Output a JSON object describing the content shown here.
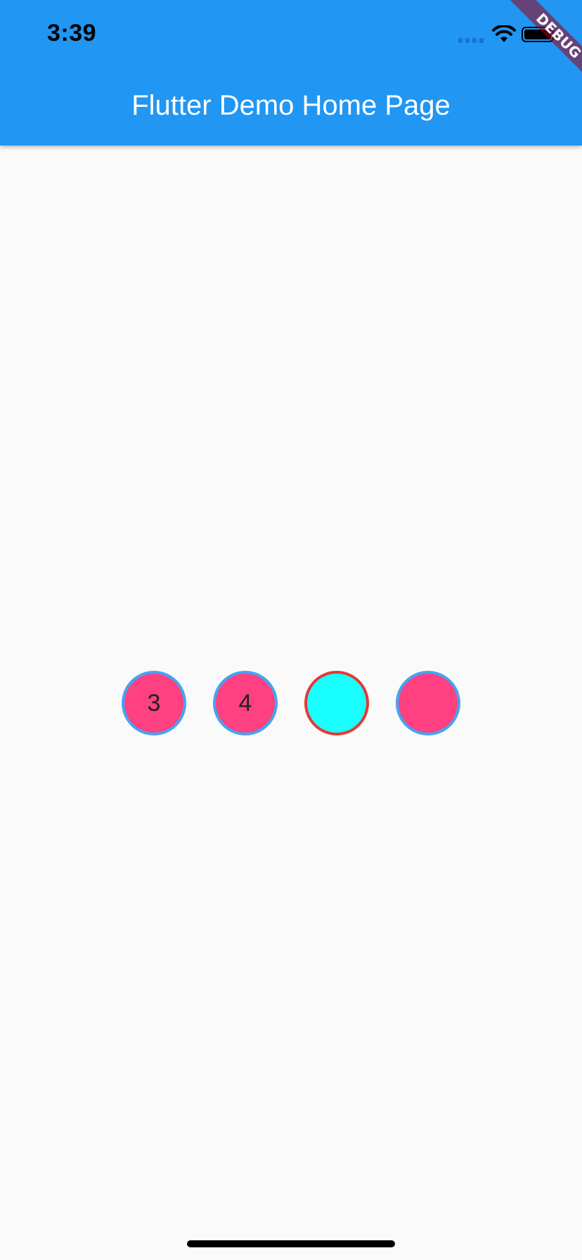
{
  "status_bar": {
    "time": "3:39"
  },
  "app_bar": {
    "title": "Flutter Demo Home Page",
    "color": "#2196f3"
  },
  "debug_banner": {
    "label": "DEBUG"
  },
  "circles": [
    {
      "label": "3",
      "fill": "#ff4081",
      "border": "#42a5f5"
    },
    {
      "label": "4",
      "fill": "#ff4081",
      "border": "#42a5f5"
    },
    {
      "label": "",
      "fill": "#18ffff",
      "border": "#e53935"
    },
    {
      "label": "",
      "fill": "#ff4081",
      "border": "#42a5f5"
    }
  ],
  "icons": {
    "signal": "cellular-signal-icon",
    "wifi": "wifi-icon",
    "battery": "battery-icon"
  }
}
